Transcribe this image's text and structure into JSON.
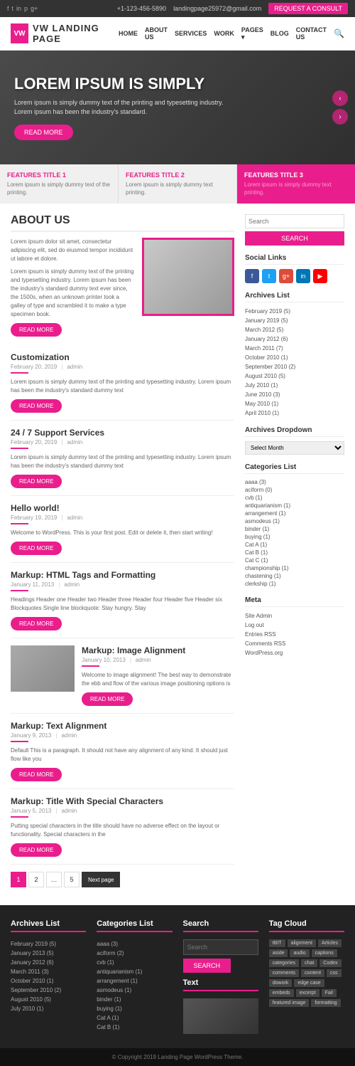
{
  "topbar": {
    "phone": "+1-123-456-5890",
    "email": "landingpage25972@gmail.com",
    "consult_btn": "REQUEST A CONSULT",
    "social_icons": [
      "f",
      "t",
      "in",
      "p",
      "g+"
    ]
  },
  "header": {
    "logo_text": "VW LANDING PAGE",
    "nav": [
      "HOME",
      "ABOUT US",
      "SERVICES",
      "WORK",
      "PAGES",
      "BLOG",
      "CONTACT US"
    ]
  },
  "hero": {
    "title": "LOREM IPSUM IS SIMPLY",
    "subtitle1": "Lorem ipsum is simply dummy text of the printing and typesetting industry.",
    "subtitle2": "Lorem ipsum has been the industry's standard.",
    "btn": "READ MORE"
  },
  "features": [
    {
      "title": "FEATURES TITLE 1",
      "desc": "Lorem ipsum is simply dummy text of the printing."
    },
    {
      "title": "FEATURES TITLE 2",
      "desc": "Lorem ipsum is simply dummy text printing."
    },
    {
      "title": "FEATURES TITLE 3",
      "desc": "Lorem ipsum is simply dummy text printing."
    }
  ],
  "about": {
    "title": "ABOUT US",
    "para1": "Lorem ipsum dolor sit amet, consectetur adipiscing elit, sed do eiusmod tempor incididunt ut labore et dolore.",
    "para2": "Lorem ipsum is simply dummy text of the printing and typesetting industry. Lorem ipsum has been the industry's standard dummy text ever since, the 1500s, when an unknown printer took a galley of type and scrambled it to make a type specimen book.",
    "btn": "READ MORE"
  },
  "posts": [
    {
      "title": "Customization",
      "date": "February 20, 2019",
      "author": "admin",
      "excerpt": "Lorem ipsum is simply dummy text of the printing and typesetting industry. Lorem ipsum has been the industry's standard dummy text",
      "btn": "READ MORE"
    },
    {
      "title": "24 / 7 Support Services",
      "date": "February 20, 2019",
      "author": "admin",
      "excerpt": "Lorem ipsum is simply dummy text of the printing and typesetting industry. Lorem ipsum has been the industry's standard dummy text",
      "btn": "READ MORE"
    },
    {
      "title": "Hello world!",
      "date": "February 19, 2019",
      "author": "admin",
      "excerpt": "Welcome to WordPress. This is your first post. Edit or delete it, then start writing!",
      "btn": "READ MORE"
    },
    {
      "title": "Markup: HTML Tags and Formatting",
      "date": "January 11, 2013",
      "author": "admin",
      "excerpt": "Headings Header one Header two Header three Header four Header five Header six Blockquotes Single line blockquote: Stay hungry. Stay",
      "btn": "READ MORE"
    },
    {
      "title": "Markup: Image Alignment",
      "date": "January 10, 2013",
      "author": "admin",
      "excerpt": "Welcome to image alignment! The best way to demonstrate the ebb and flow of the various image positioning options is",
      "btn": "READ MORE",
      "has_image": true
    },
    {
      "title": "Markup: Text Alignment",
      "date": "January 9, 2013",
      "author": "admin",
      "excerpt": "Default This is a paragraph. It should not have any alignment of any kind. It should just flow like you",
      "btn": "READ MORE"
    },
    {
      "title": "Markup: Title With Special Characters",
      "date": "January 5, 2013",
      "author": "admin",
      "excerpt": "Putting special characters in the title should have no adverse effect on the layout or functionality. Special characters in the",
      "btn": "READ MORE"
    }
  ],
  "pagination": {
    "pages": [
      "1",
      "2",
      "…",
      "5"
    ],
    "next": "Next page"
  },
  "sidebar": {
    "search_placeholder": "Search",
    "search_btn": "SEARCH",
    "social_title": "Social Links",
    "archives_title": "Archives List",
    "archives": [
      "February 2019 (5)",
      "January 2019 (5)",
      "March 2012 (5)",
      "January 2012 (6)",
      "March 2011 (7)",
      "October 2010 (1)",
      "September 2010 (2)",
      "August 2010 (5)",
      "July 2010 (1)",
      "June 2010 (3)",
      "May 2010 (1)",
      "April 2010 (1)"
    ],
    "dropdown_title": "Archives Dropdown",
    "dropdown_placeholder": "Select Month",
    "categories_title": "Categories List",
    "categories": [
      "aaaa (3)",
      "aciform (0)",
      "cvb (1)",
      "antiquarianism (1)",
      "arrangement (1)",
      "asmodeus (1)",
      "binder (1)",
      "buying (1)",
      "Cat A (1)",
      "Cat B (1)",
      "Cat C (1)",
      "championship (1)",
      "chastening (1)",
      "clerkship (1)"
    ],
    "meta_title": "Meta",
    "meta_items": [
      "Site Admin",
      "Log out",
      "Entries RSS",
      "Comments RSS",
      "WordPress.org"
    ]
  },
  "footer": {
    "archives_title": "Archives List",
    "archives": [
      "February 2019 (5)",
      "January 2013 (5)",
      "January 2012 (6)",
      "March 2011 (3)",
      "October 2010 (1)",
      "September 2010 (2)",
      "August 2010 (5)",
      "July 2010 (1)"
    ],
    "categories_title": "Categories List",
    "categories": [
      "aaaa (3)",
      "aciform (2)",
      "cvb (1)",
      "antiquarianism (1)",
      "arrangement (1)",
      "asmodeus (1)",
      "binder (1)",
      "buying (1)",
      "Cat A (1)",
      "Cat B (1)"
    ],
    "search_title": "Search",
    "search_placeholder": "Search",
    "search_btn": "SEARCH",
    "text_title": "Text",
    "tag_cloud_title": "Tag Cloud",
    "tags": [
      "tBIT",
      "alignment",
      "Articles",
      "aside",
      "audio",
      "captions",
      "categories",
      "chat",
      "Codex",
      "comments",
      "content",
      "css",
      "dowork",
      "edge case",
      "embeds",
      "excerpt",
      "Fail",
      "featured image",
      "formatting"
    ],
    "copyright": "© Copyright 2019 Landing Page WordPress Theme."
  }
}
